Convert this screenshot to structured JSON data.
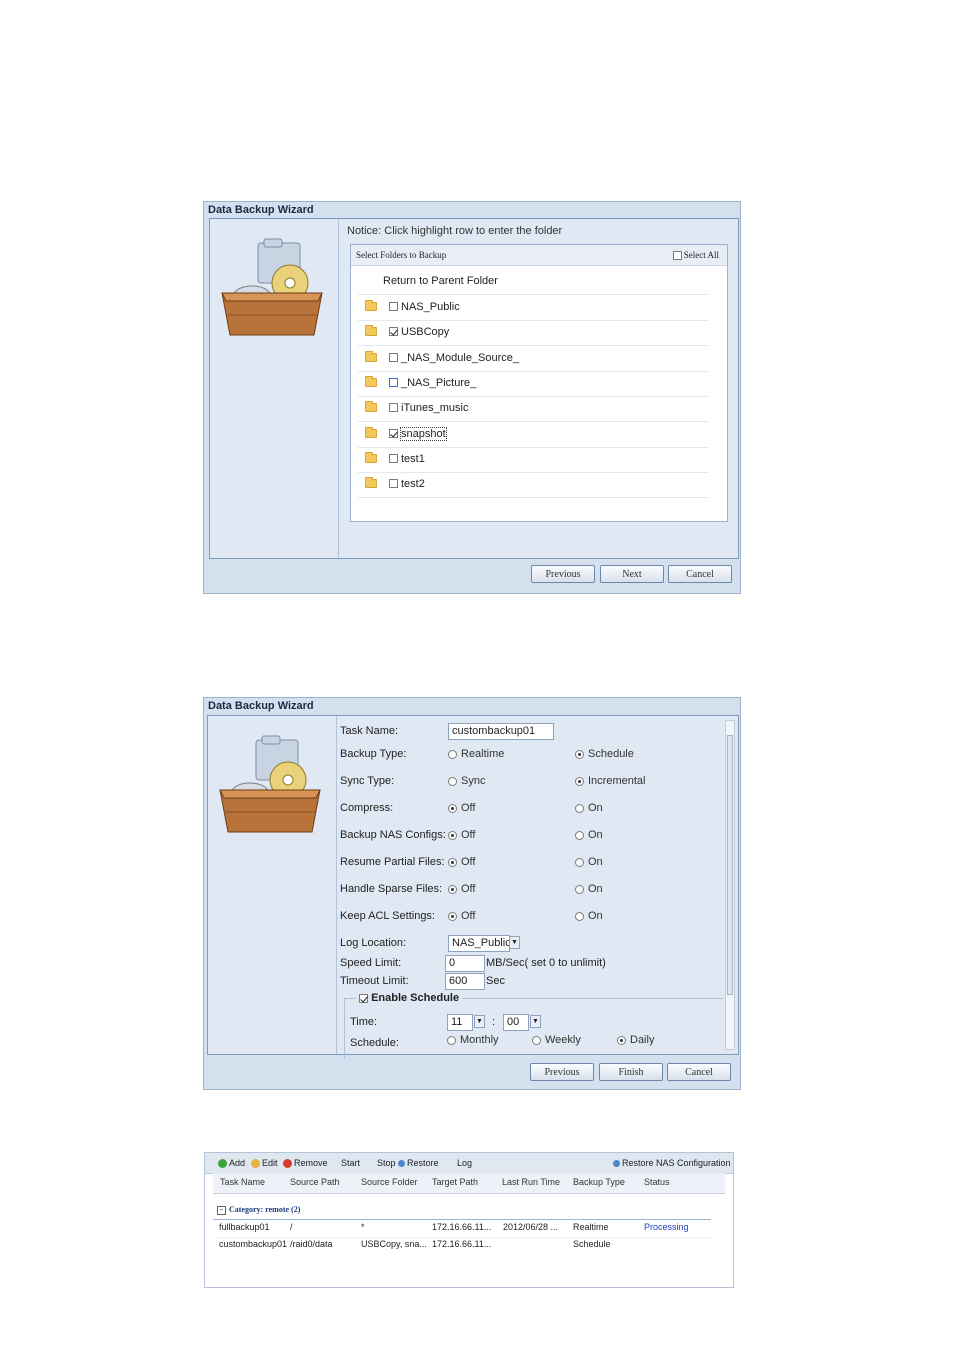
{
  "wizard1": {
    "title": "Data Backup Wizard",
    "notice": "Notice: Click highlight row to enter the folder",
    "panel_header": "Select Folders to Backup",
    "select_all": "Select All",
    "return_parent": "Return to Parent Folder",
    "folders": [
      {
        "name": "NAS_Public",
        "checked": false
      },
      {
        "name": "USBCopy",
        "checked": true
      },
      {
        "name": "_NAS_Module_Source_",
        "checked": false
      },
      {
        "name": "_NAS_Picture_",
        "checked": false
      },
      {
        "name": "iTunes_music",
        "checked": false
      },
      {
        "name": "snapshot",
        "checked": true
      },
      {
        "name": "test1",
        "checked": false
      },
      {
        "name": "test2",
        "checked": false
      }
    ],
    "buttons": {
      "previous": "Previous",
      "next": "Next",
      "cancel": "Cancel"
    }
  },
  "wizard2": {
    "title": "Data Backup Wizard",
    "task_name_label": "Task Name:",
    "task_name_value": "custombackup01",
    "backup_type_label": "Backup Type:",
    "backup_type_options": [
      "Realtime",
      "Schedule"
    ],
    "backup_type_selected": "Schedule",
    "sync_type_label": "Sync Type:",
    "sync_type_options": [
      "Sync",
      "Incremental"
    ],
    "sync_type_selected": "Incremental",
    "compress_label": "Compress:",
    "backup_nas_configs_label": "Backup NAS Configs:",
    "resume_partial_label": "Resume Partial Files:",
    "handle_sparse_label": "Handle Sparse Files:",
    "keep_acl_label": "Keep ACL Settings:",
    "off_label": "Off",
    "on_label": "On",
    "log_location_label": "Log Location:",
    "log_location_value": "NAS_Public",
    "speed_limit_label": "Speed Limit:",
    "speed_limit_value": "0",
    "speed_limit_unit": "MB/Sec( set 0 to unlimit)",
    "timeout_limit_label": "Timeout Limit:",
    "timeout_limit_value": "600",
    "timeout_limit_unit": "Sec",
    "enable_schedule_label": "Enable Schedule",
    "time_label": "Time:",
    "time_hour": "11",
    "time_sep": ":",
    "time_minute": "00",
    "schedule_label": "Schedule:",
    "schedule_options": [
      "Monthly",
      "Weekly",
      "Daily"
    ],
    "schedule_selected": "Daily",
    "buttons": {
      "previous": "Previous",
      "finish": "Finish",
      "cancel": "Cancel"
    }
  },
  "tasklist": {
    "toolbar": {
      "add": "Add",
      "edit": "Edit",
      "remove": "Remove",
      "start": "Start",
      "stop": "Stop",
      "restore": "Restore",
      "log": "Log",
      "restore_nas_config": "Restore NAS Configuration"
    },
    "columns": [
      "Task Name",
      "Source Path",
      "Source Folder",
      "Target Path",
      "Last Run Time",
      "Backup Type",
      "Status"
    ],
    "category": "Category: remote (2)",
    "rows": [
      [
        "fullbackup01",
        "/",
        "*",
        "172.16.66.11...",
        "2012/06/28 ...",
        "Realtime",
        "Processing"
      ],
      [
        "custombackup01",
        "/raid0/data",
        "USBCopy, sna...",
        "172.16.66.11...",
        "",
        "Schedule",
        ""
      ]
    ]
  },
  "colors": {
    "status_processing": "#1f3fc4",
    "window_bg": "#d5e0ee"
  }
}
